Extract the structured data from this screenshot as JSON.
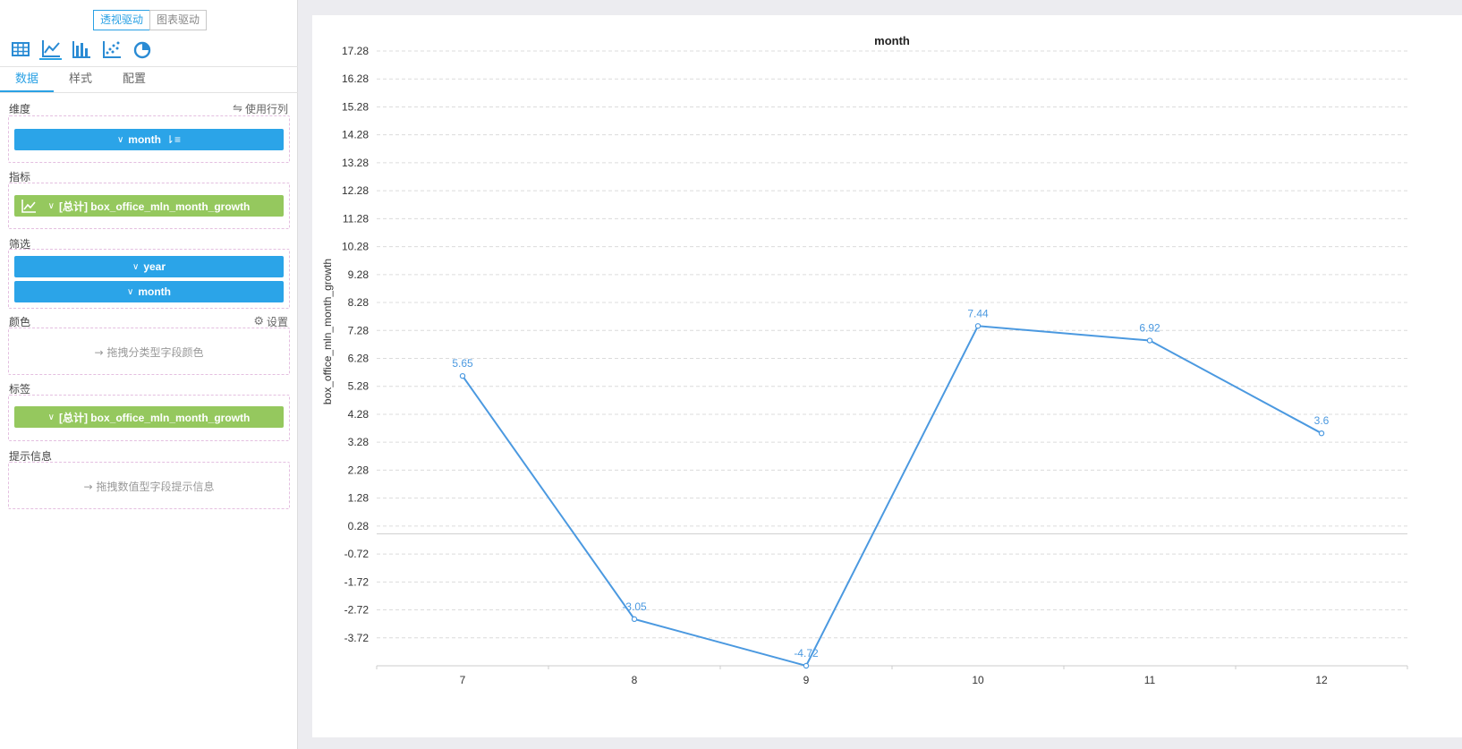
{
  "mode_toggle": {
    "pivot_label": "透视驱动",
    "chart_label": "图表驱动"
  },
  "chart_types": [
    {
      "icon": "table-icon"
    },
    {
      "icon": "line-chart-icon",
      "active": true
    },
    {
      "icon": "bar-chart-icon"
    },
    {
      "icon": "scatter-chart-icon"
    },
    {
      "icon": "pie-chart-icon"
    }
  ],
  "tabs": [
    {
      "label": "数据",
      "active": true
    },
    {
      "label": "样式"
    },
    {
      "label": "配置"
    }
  ],
  "sections": {
    "dimension": {
      "label": "维度",
      "action": "使用行列",
      "pill": "month"
    },
    "metric": {
      "label": "指标",
      "pill": "[总计] box_office_mln_month_growth"
    },
    "filter": {
      "label": "筛选",
      "pills": [
        "year",
        "month"
      ]
    },
    "color": {
      "label": "颜色",
      "action": "设置",
      "placeholder": "拖拽分类型字段颜色"
    },
    "tag": {
      "label": "标签",
      "pill": "[总计] box_office_mln_month_growth"
    },
    "tooltip": {
      "label": "提示信息",
      "placeholder": "拖拽数值型字段提示信息"
    }
  },
  "colors": {
    "accent": "#2aa1e4",
    "pill_blue": "#2ba4e8",
    "pill_green": "#95c85e",
    "line": "#4b99e0"
  },
  "chart_data": {
    "type": "line",
    "title": "month",
    "xlabel": "",
    "ylabel": "box_office_mln_month_growth",
    "categories": [
      "7",
      "8",
      "9",
      "10",
      "11",
      "12"
    ],
    "series": [
      {
        "values": [
          5.65,
          -3.05,
          -4.72,
          7.44,
          6.92,
          3.6
        ]
      }
    ],
    "data_labels": [
      "5.65",
      "-3.05",
      "-4.72",
      "7.44",
      "6.92",
      "3.6"
    ],
    "yticks": [
      "17.28",
      "16.28",
      "15.28",
      "14.28",
      "13.28",
      "12.28",
      "11.28",
      "10.28",
      "9.28",
      "8.28",
      "7.28",
      "6.28",
      "5.28",
      "4.28",
      "3.28",
      "2.28",
      "1.28",
      "0.28",
      "-0.72",
      "-1.72",
      "-2.72",
      "-3.72"
    ],
    "ylim": [
      -4.72,
      17.28
    ],
    "grid": true,
    "legend": "none"
  }
}
